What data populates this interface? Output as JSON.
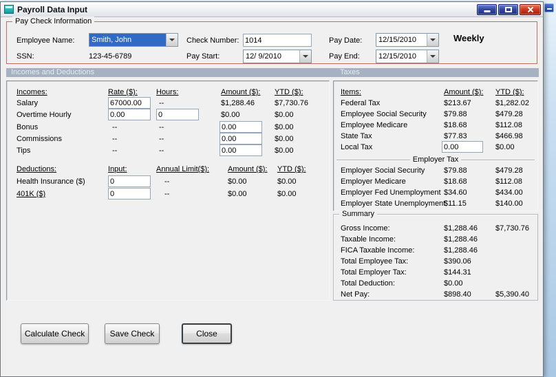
{
  "colors": {
    "selection_blue": "#316ac5",
    "section_band": "#a6b2c2",
    "paycheck_group_border": "#bd6e66",
    "close_button_red": "#cf3a21",
    "titlebar_button_blue": "#35479e"
  },
  "window": {
    "title": "Payroll Data Input"
  },
  "paycheck": {
    "caption": "Pay Check Information",
    "employee_name_label": "Employee Name:",
    "employee_name_value": "Smith, John",
    "ssn_label": "SSN:",
    "ssn_value": "123-45-6789",
    "check_number_label": "Check Number:",
    "check_number_value": "1014",
    "pay_start_label": "Pay Start:",
    "pay_start_value": "12/ 9/2010",
    "pay_date_label": "Pay Date:",
    "pay_date_value": "12/15/2010",
    "pay_end_label": "Pay End:",
    "pay_end_value": "12/15/2010",
    "frequency": "Weekly"
  },
  "bands": {
    "incomes_deductions": "Incomes and Deductions",
    "taxes": "Taxes"
  },
  "incomes": {
    "headers": {
      "c1": "Incomes:",
      "c2": "Rate ($):",
      "c3": "Hours:",
      "c4": "Amount ($):",
      "c5": "YTD ($):"
    },
    "salary": {
      "label": "Salary",
      "rate": "67000.00",
      "hours": "--",
      "amount": "$1,288.46",
      "ytd": "$7,730.76"
    },
    "overtime": {
      "label": "Overtime Hourly",
      "rate": "0.00",
      "hours": "0",
      "amount": "$0.00",
      "ytd": "$0.00"
    },
    "bonus": {
      "label": "Bonus",
      "rate": "--",
      "hours": "--",
      "amount": "0.00",
      "ytd": "$0.00"
    },
    "commissions": {
      "label": "Commissions",
      "rate": "--",
      "hours": "--",
      "amount": "0.00",
      "ytd": "$0.00"
    },
    "tips": {
      "label": "Tips",
      "rate": "--",
      "hours": "--",
      "amount": "0.00",
      "ytd": "$0.00"
    }
  },
  "deductions": {
    "headers": {
      "c1": "Deductions:",
      "c2": "Input:",
      "c3": "Annual Limit($):",
      "c4": "Amount ($):",
      "c5": "YTD ($):"
    },
    "health": {
      "label": "Health Insurance ($)",
      "input": "0",
      "limit": "--",
      "amount": "$0.00",
      "ytd": "$0.00"
    },
    "k401": {
      "label": "401K ($)",
      "input": "0",
      "limit": "--",
      "amount": "$0.00",
      "ytd": "$0.00"
    }
  },
  "taxes": {
    "headers": {
      "items": "Items:",
      "amount": "Amount ($):",
      "ytd": "YTD ($):"
    },
    "federal": {
      "label": "Federal Tax",
      "amount": "$213.67",
      "ytd": "$1,282.02"
    },
    "emp_ss": {
      "label": "Employee Social Security",
      "amount": "$79.88",
      "ytd": "$479.28"
    },
    "emp_medicare": {
      "label": "Employee Medicare",
      "amount": "$18.68",
      "ytd": "$112.08"
    },
    "state": {
      "label": "State Tax",
      "amount": "$77.83",
      "ytd": "$466.98"
    },
    "local": {
      "label": "Local Tax",
      "amount": "0.00",
      "ytd": "$0.00"
    },
    "employer_header": "Employer Tax",
    "empr_ss": {
      "label": "Employer Social Security",
      "amount": "$79.88",
      "ytd": "$479.28"
    },
    "empr_medicare": {
      "label": "Employer Medicare",
      "amount": "$18.68",
      "ytd": "$112.08"
    },
    "empr_fed_unemp": {
      "label": "Employer Fed Unemployment",
      "amount": "$34.60",
      "ytd": "$434.00"
    },
    "empr_state_unemp": {
      "label": "Employer State Unemployment",
      "amount": "$11.15",
      "ytd": "$140.00"
    }
  },
  "summary": {
    "caption": "Summary",
    "gross": {
      "label": "Gross Income:",
      "amount": "$1,288.46",
      "ytd": "$7,730.76"
    },
    "taxable": {
      "label": "Taxable Income:",
      "amount": "$1,288.46"
    },
    "fica": {
      "label": "FICA Taxable Income:",
      "amount": "$1,288.46"
    },
    "total_employee_tax": {
      "label": "Total Employee Tax:",
      "amount": "$390.06"
    },
    "total_employer_tax": {
      "label": "Total Employer Tax:",
      "amount": "$144.31"
    },
    "total_deduction": {
      "label": "Total Deduction:",
      "amount": "$0.00"
    },
    "net_pay": {
      "label": "Net Pay:",
      "amount": "$898.40",
      "ytd": "$5,390.40"
    }
  },
  "buttons": {
    "calculate": "Calculate Check",
    "save": "Save Check",
    "close": "Close"
  }
}
